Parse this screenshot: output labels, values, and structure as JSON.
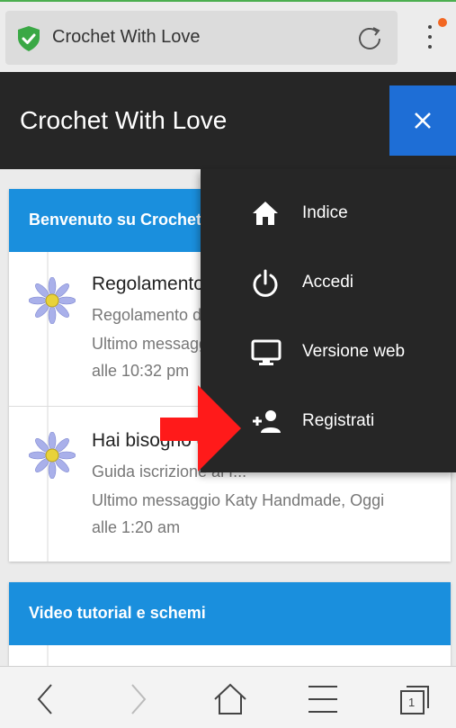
{
  "browser": {
    "url_title": "Crochet With Love"
  },
  "header": {
    "title": "Crochet With Love"
  },
  "menu": {
    "items": [
      {
        "label": "Indice",
        "icon": "home-icon"
      },
      {
        "label": "Accedi",
        "icon": "power-icon"
      },
      {
        "label": "Versione web",
        "icon": "monitor-icon"
      },
      {
        "label": "Registrati",
        "icon": "add-user-icon"
      }
    ]
  },
  "panels": [
    {
      "title": "Benvenuto su Crochet With Love",
      "topics": [
        {
          "title": "Regolamento",
          "lines": [
            "Regolamento del forum",
            "Ultimo messaggio Admin, Oggi",
            "alle 10:32 pm"
          ]
        },
        {
          "title": "Hai bisogno di aiuto?",
          "lines": [
            "Guida iscrizione al f...",
            "Ultimo messaggio Katy Handmade, Oggi",
            "alle 1:20 am"
          ]
        }
      ]
    },
    {
      "title": "Video tutorial e schemi",
      "topics": []
    }
  ],
  "toolbar": {
    "tab_count": "1"
  },
  "colors": {
    "accent_blue": "#1a8fdd",
    "close_blue": "#1e6ed6",
    "header_dark": "#262626",
    "arrow_red": "#ff1a1a",
    "shield_green": "#3aa845"
  }
}
